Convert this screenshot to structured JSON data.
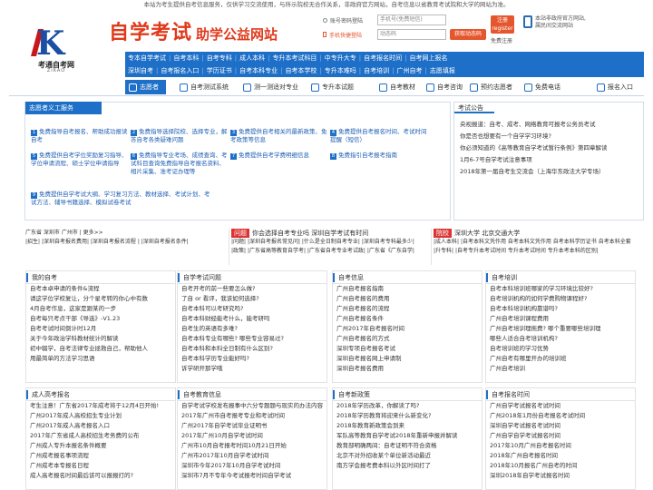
{
  "top_notice": "本站为考生提供自考信息服务，仅供学习交流使用，与所示院校无合作关系，非政府官方网站，自考信息以省教育考试院和大学的网站为准。",
  "logo": {
    "letter": "K",
    "name": "考通自考网",
    "sub": "ZIKAO"
  },
  "brand": {
    "title": "自学考试",
    "subtitle": "助学公益网站"
  },
  "login": {
    "account_label": "账号密码登陆",
    "phone_label": "手机快捷登陆",
    "phone_placeholder": "手机号(免费短信)",
    "code_placeholder": "动态码",
    "get_code": "获取动态码",
    "register": "注册 register",
    "forget": "免费注册",
    "mobile_text1": "本站非政府官方网站,",
    "mobile_text2": "属民间交流网站"
  },
  "nav": {
    "line1": [
      "专本自学考试",
      "自考本科",
      "自考专科",
      "成人本科",
      "专升本考试科目",
      "中专升大专",
      "自考报名时间",
      "自考网上报名"
    ],
    "line2": [
      "深圳自考",
      "自考报名入口",
      "学历证书",
      "自考本科专业",
      "自考本学校",
      "专升本难吗",
      "自考培训",
      "广州自考",
      "志愿填报"
    ]
  },
  "icobar": [
    "志愿者",
    "自考测试系统",
    "测一测适对专业",
    "专升本试题",
    "自考教材",
    "自考咨询",
    "预约志愿者",
    "免费电话",
    "报名入口"
  ],
  "volunteer": {
    "title": "志愿者义工服务",
    "items": [
      {
        "n": "1",
        "t": "免费指导自考报名、帮助成功报读自考"
      },
      {
        "n": "2",
        "t": "免费指导选择院校、选择专业，解答自考各类疑难问题"
      },
      {
        "n": "3",
        "t": "免费提供自考相关的最新政策、免考政策等信息"
      },
      {
        "n": "4",
        "t": "免费提供自考报名时间、考试时间提醒（短信）"
      },
      {
        "n": "5",
        "t": "免费提供自考学位奖励复习指导、学位申请流程、硕士学位申请指导"
      },
      {
        "n": "6",
        "t": "免费指导专业考场、成绩查询、考试科目查询免费指导自考报名资料、相片采集、准考证办理等"
      },
      {
        "n": "7",
        "t": "免费提供自考学费明细信息"
      },
      {
        "n": "8",
        "t": "免费指引自考报考指南"
      },
      {
        "n": "9",
        "t": "免费提供自学考试大纲、学习复习方法、教材选择、考试计划、考试方法、辅导书籍选择、模拟试卷考试"
      }
    ]
  },
  "announce": {
    "title": "考试公告",
    "items": [
      "央视报道：自考、成考、网络教育可报考公务员考试",
      "你是否也想要有一个自学学习环境?",
      "你必须知道的《高等教育自学考试暂行条例》第四章解读",
      "1月6-7号自学考试注意事项",
      "2018年第一届自考生交流会（上海华东政法大学专场）"
    ]
  },
  "links_left": {
    "l1": "广东省 深圳市 广州市 |  更多>>",
    "l2": "|招生| |深圳自考报名费用| |深圳自考报名流程 | |深圳自考报名条件|"
  },
  "links_mid": {
    "badge": "问题",
    "title": "你会选择自考专业吗 深圳自学考试有时间",
    "l1": "|问题| |深圳自考报名常见问| |什么是全日制自考专业| |深圳自考专科最多少|",
    "l2": "|政策| |广东省高等教育自学考| |广东省自考专业考试政| |广东省《广东自学|"
  },
  "links_right": {
    "badge": "院校",
    "title": "深圳大学 北京交通大学",
    "l1": "|成人本科| |自考本科文凭作用 自考本科文凭作用 自考本科学历证书 自考本科全套",
    "l2": "|升专科| |自考专升本考试时间 专升本考试时间 专升本考本科的区别|"
  },
  "sections": [
    {
      "title": "我的自考",
      "items": [
        "自考本卓申请的条件&流程",
        "请这学位学校复让，分个星考转的你心中有数",
        "4月自考作息，这家是跟某的一步",
        "自考每只考点干部《导选》-V1.23",
        "自考考试时间倒计时12月",
        "关于今年政治学科教材统计的解读",
        "初中辍学，自考法律专业拯救自己，帮助他人",
        "用最简单的方法学习思语"
      ]
    },
    {
      "title": "自学考试问题",
      "items": [
        "自考开考的前一些要怎么做?",
        "了自 or 看评，我该如何选择?",
        "自考本科可以考研究吗?",
        "自考本科财经能考什么，能考研吗",
        "自考生的英语有多难?",
        "自考本科专业有哪些? 哪些专业容易过?",
        "自考本科和本科全日制有什么区别?",
        "自考本科学历专业能好吗?",
        "诉学研开那学哦"
      ]
    },
    {
      "title": "自考信息",
      "items": [
        "广州自考报名指南",
        "广州自考报名的费用",
        "广州自考报名的流程",
        "广州自考报名条件",
        "广州2017年自考报名时间",
        "广州自考报名的方式",
        "深圳专项自考报名考试",
        "深圳自考报名网上申请制",
        "深圳自考报名费用"
      ]
    },
    {
      "title": "自考培训",
      "items": [
        "自考本科培训班哪家的学习环境比较好?",
        "自考培训机构的如何学费购物课程好?",
        "自考本科培训机构靠谱吗?",
        "广州自考培训课程费用",
        "广州自考培训理拖费?  哪个重要哪些培训理",
        "哪些人适合自考培训机构?",
        "自考培训班的学习优势",
        "广州自考有哪里开办的培训班",
        "广州自考培训"
      ]
    },
    {
      "title": "成人高考报名",
      "items": [
        "考生注意！广东省2017年成考将于12月4日开始!",
        "广州2017年成人高校招生专业计划",
        "广州2017年成人高考报名入口",
        "2017年广东省成人高校招生考务费的公布",
        "广州成人专升本报名条件概要",
        "广州成考报名事项流程",
        "广州成考本专报名日程",
        "成人高考报名时间最后该可以报报打的?"
      ]
    },
    {
      "title": "自考教育信息",
      "items": [
        "自学考试学校发布报事中六分专题题与现实的办法内容",
        "2017年广州市自考报考专业和考试时间",
        "广州2017年自学考试毕业证明书",
        "2017年广州10月自学考试时间",
        "广州市10月自考报考时间10月21日开始",
        "广州市2017年10月自学考试时间",
        "深圳市今年2017年10月自学考试时间",
        "深圳市7月不专年今考试报考时间自学考试"
      ]
    },
    {
      "title": "自考新政策",
      "items": [
        "2018年学历改革，你解读了吗?",
        "2018年学历教育将迎来什么新变化?",
        "2018年教育新政策会到来",
        "军队高等教育自学考试2018年重新申报并解读",
        "教育部明确两间：自考证明不符合资格",
        "北京不对外招收某个单位新活动最近",
        "南方学会报考费本科以外区时间打了"
      ]
    },
    {
      "title": "自考报名时间",
      "items": [
        "广州自学考试报名考试时间",
        "广州2018年1月份自考报名考试时间",
        "深圳自学考试报名考试时间",
        "广州自学自学考试报名时间",
        "2017年10月广州自考报名时间",
        "2018年广州自考报名时间",
        "2018年10月报名广州自考的时间",
        "深圳2018年自学考试报名时间"
      ]
    }
  ]
}
